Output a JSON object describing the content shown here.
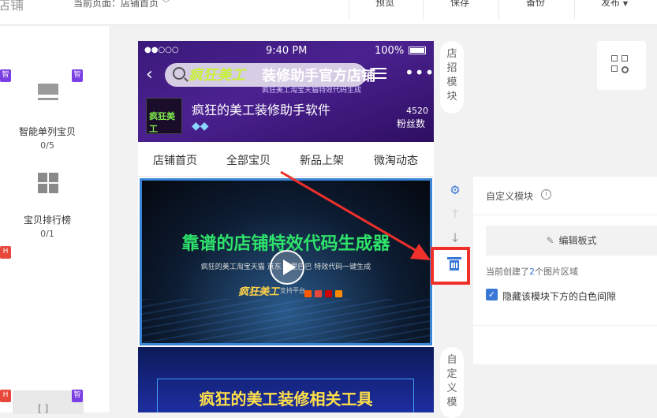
{
  "topbar": {
    "logo_text": "店铺",
    "current_page_label": "当前页面：店铺首页",
    "preview_label": "预览",
    "save_label": "保存",
    "backup_label": "备份",
    "publish_label": "发布"
  },
  "left_panel": {
    "items": [
      {
        "label": "智能单列宝贝",
        "count": "0/5",
        "badge": "智"
      },
      {
        "label": "宝贝排行榜",
        "count": "0/1",
        "badge": "H"
      }
    ],
    "badge_texts": [
      "智",
      "智",
      "H",
      "H",
      "智"
    ]
  },
  "phone": {
    "status": {
      "signal": "●●○○○",
      "time": "9:40 PM",
      "battery": "100%"
    },
    "search_brand": "疯狂美工",
    "header_title": "装修助手官方店铺",
    "header_subtitle": "疯狂美工淘宝天猫特效代码生成",
    "shop_name": "疯狂的美工装修助手软件",
    "fans_count": "4520",
    "fans_label": "粉丝数",
    "logo_text": "疯狂美工",
    "tabs": [
      "店铺首页",
      "全部宝贝",
      "新品上架",
      "微淘动态"
    ],
    "banner": {
      "title": "靠谱的店铺特效代码生成器",
      "subtitle": "疯狂的美工淘宝天猫 京东 阿里巴巴 特效代码一键生成",
      "brand": "疯狂美工",
      "support": "支持平台"
    },
    "banner2_text": "疯狂的美工装修相关工具"
  },
  "side_tags": {
    "top": "店招模块",
    "bottom": "自定义模"
  },
  "right_panel": {
    "title": "自定义模块",
    "info_icon": "i",
    "edit_button": "编辑板式",
    "note_prefix": "当前创建了",
    "note_count": "2",
    "note_suffix": "个图片区域",
    "checkbox_label": "隐藏该模块下方的白色间隙",
    "checkbox_checked": true
  },
  "colors": {
    "accent": "#3a78d8",
    "highlight": "#f0302a",
    "purple_badge": "#7b3fe4",
    "red_badge": "#e8473b"
  }
}
